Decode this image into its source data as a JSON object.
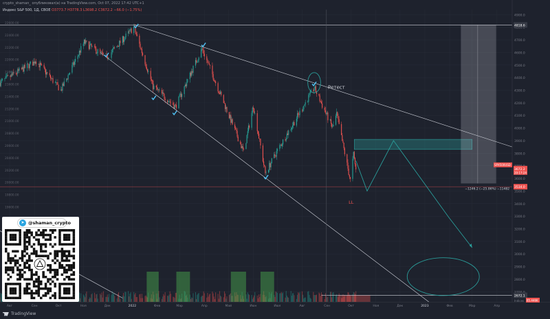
{
  "header": {
    "publisher_line": "crypto_shaman_ опубликовал(а) на TradingView.com, Oct 07, 2022 17:42 UTC+1",
    "symbol_line": "Индекс S&P 500, 1Д, CBOE",
    "ohlc_line": "O3773.7 H3778.3 L3698.2 C3672.2 −66.0 (−1.75%)"
  },
  "annotations": {
    "retest_label": "Ретест",
    "ll_label": "LL",
    "measure_text": "−1246.2 (−25.86%) −11482"
  },
  "price_axis": {
    "ticks": [
      "4900.0",
      "4800.0",
      "4700.0",
      "4600.0",
      "4500.0",
      "4400.0",
      "4300.0",
      "4200.0",
      "4100.0",
      "4000.0",
      "3900.0",
      "3800.0",
      "3700.0",
      "3600.0",
      "3500.0",
      "3400.0",
      "3300.0",
      "3200.0",
      "3100.0",
      "3000.0",
      "2900.0",
      "2800.0",
      "2700.0",
      "2600.0"
    ],
    "current_price_label": "3672.2",
    "current_tag": "SPX500USD",
    "current_timer": "20:17:24",
    "target_label": "3534.0",
    "low_label": "2672.1",
    "top_label": "4818.6"
  },
  "left_axis": {
    "ticks": [
      "22600.00",
      "22400.00",
      "22200.00",
      "22000.00",
      "21800.00",
      "21600.00",
      "21400.00",
      "21200.00",
      "21000.00",
      "20800.00",
      "20600.00",
      "20400.00",
      "20200.00",
      "20000.00",
      "19800.00",
      "19600.00",
      "19400.00",
      "19200.00"
    ]
  },
  "time_axis": {
    "labels": [
      "Авг",
      "Сен",
      "Окт",
      "Ноя",
      "Дек",
      "2022",
      "Фев",
      "Мар",
      "Апр",
      "Май",
      "Июн",
      "Июл",
      "Авг",
      "Сен",
      "Окт",
      "Ноя",
      "Дек",
      "2023",
      "Фев",
      "Мар",
      "Апр"
    ]
  },
  "qr_card": {
    "handle": "@shaman_crypto"
  },
  "branding": {
    "name": "TradingView"
  },
  "colors": {
    "background": "#1e222d",
    "up": "#26a69a",
    "down": "#ef5350",
    "trendline": "#d1d4dc",
    "projection": "#2a9d9a",
    "check": "#4fc3f7"
  },
  "chart_data": {
    "type": "candlestick",
    "title": "Индекс S&P 500, 1Д, CBOE",
    "xlabel": "",
    "ylabel": "",
    "ylim": [
      2600,
      4950
    ],
    "x_range": [
      "2021-07-20",
      "2023-04-20"
    ],
    "candles": {
      "start": "2021-07-20",
      "end": "2022-10-07",
      "price_path": [
        [
          "2021-07-20",
          4360
        ],
        [
          "2021-08-31",
          4520
        ],
        [
          "2021-09-02",
          4540
        ],
        [
          "2021-10-04",
          4300
        ],
        [
          "2021-11-02",
          4680
        ],
        [
          "2021-11-30",
          4560
        ],
        [
          "2022-01-03",
          4800
        ],
        [
          "2022-01-27",
          4330
        ],
        [
          "2022-02-24",
          4170
        ],
        [
          "2022-03-29",
          4630
        ],
        [
          "2022-05-20",
          3810
        ],
        [
          "2022-06-01",
          4180
        ],
        [
          "2022-06-16",
          3640
        ],
        [
          "2022-07-01",
          3820
        ],
        [
          "2022-08-16",
          4320
        ],
        [
          "2022-09-08",
          4000
        ],
        [
          "2022-09-13",
          4110
        ],
        [
          "2022-09-30",
          3585
        ],
        [
          "2022-10-04",
          3790
        ],
        [
          "2022-10-07",
          3672
        ]
      ]
    },
    "trendlines": [
      {
        "from": [
          "2022-01-04",
          4818
        ],
        "to": [
          "2023-04-20",
          3850
        ]
      },
      {
        "from": [
          "2021-11-22",
          4600
        ],
        "to": [
          "2023-01-10",
          2600
        ]
      },
      {
        "from": [
          "2021-07-01",
          3250
        ],
        "to": [
          "2021-12-20",
          2650
        ]
      }
    ],
    "horizontal_levels": [
      {
        "price": 4818.6,
        "from": "2021-07-20",
        "to": "2023-04-20"
      },
      {
        "price": 3534.0,
        "from": "2021-07-20",
        "to": "2023-04-20"
      },
      {
        "price": 2672.1,
        "from": "2022-08-25",
        "to": "2023-04-20"
      }
    ],
    "projection_path": [
      [
        "2022-10-07",
        3740
      ],
      [
        "2022-10-21",
        3500
      ],
      [
        "2022-11-23",
        3900
      ],
      [
        "2023-01-31",
        3290
      ],
      [
        "2023-03-01",
        3050
      ]
    ],
    "target_zone": {
      "from": "2022-10-05",
      "to": "2023-03-01",
      "price_low": 3830,
      "price_high": 3910
    },
    "ellipses": [
      {
        "center": [
          "2022-08-16",
          4360
        ],
        "rx_days": 8,
        "ry_price": 80
      },
      {
        "center": [
          "2023-01-24",
          2820
        ],
        "rx_days": 45,
        "ry_price": 150
      }
    ],
    "measure_zone": {
      "from": "2023-02-15",
      "to": "2023-03-31",
      "price_low": 3560,
      "price_high": 4818
    },
    "checkmarks": [
      [
        "2021-11-30",
        4580
      ],
      [
        "2022-01-06",
        4810
      ],
      [
        "2022-01-28",
        4240
      ],
      [
        "2022-02-23",
        4120
      ],
      [
        "2022-03-31",
        4660
      ],
      [
        "2022-06-17",
        3610
      ],
      [
        "2022-08-16",
        4350
      ]
    ],
    "volume_highlights": [
      [
        "2022-01-19",
        "2022-02-03"
      ],
      [
        "2022-02-25",
        "2022-03-14"
      ],
      [
        "2022-05-04",
        "2022-05-23"
      ],
      [
        "2022-06-10",
        "2022-06-27"
      ]
    ],
    "volume_labels": {
      "left": "Indices",
      "right": "85.446K"
    },
    "grid": true,
    "legend": "none"
  }
}
